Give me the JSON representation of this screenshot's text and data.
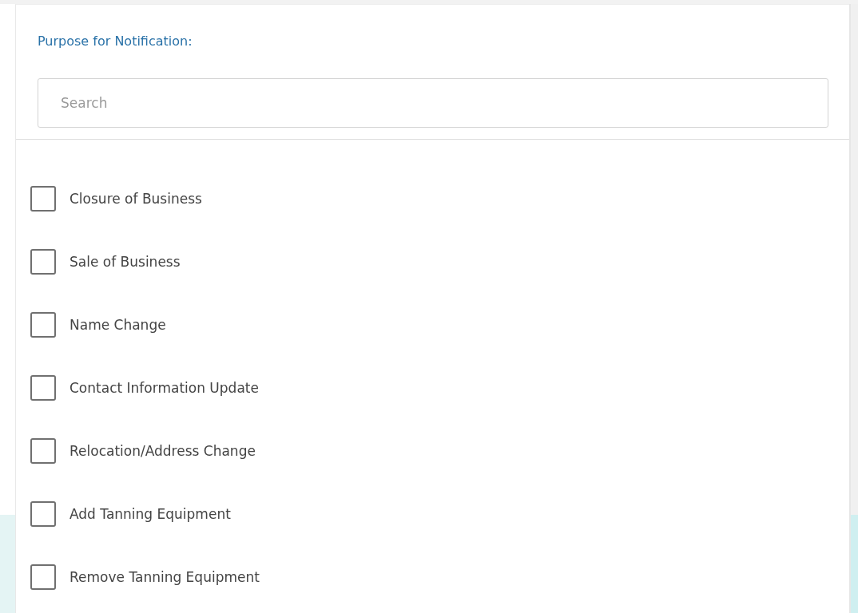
{
  "panel": {
    "title": "Purpose for Notification:"
  },
  "search": {
    "placeholder": "Search"
  },
  "options": [
    {
      "label": "Closure of Business",
      "checked": false
    },
    {
      "label": "Sale of Business",
      "checked": false
    },
    {
      "label": "Name Change",
      "checked": false
    },
    {
      "label": "Contact Information Update",
      "checked": false
    },
    {
      "label": "Relocation/Address Change",
      "checked": false
    },
    {
      "label": "Add Tanning Equipment",
      "checked": false
    },
    {
      "label": "Remove Tanning Equipment",
      "checked": false
    }
  ]
}
